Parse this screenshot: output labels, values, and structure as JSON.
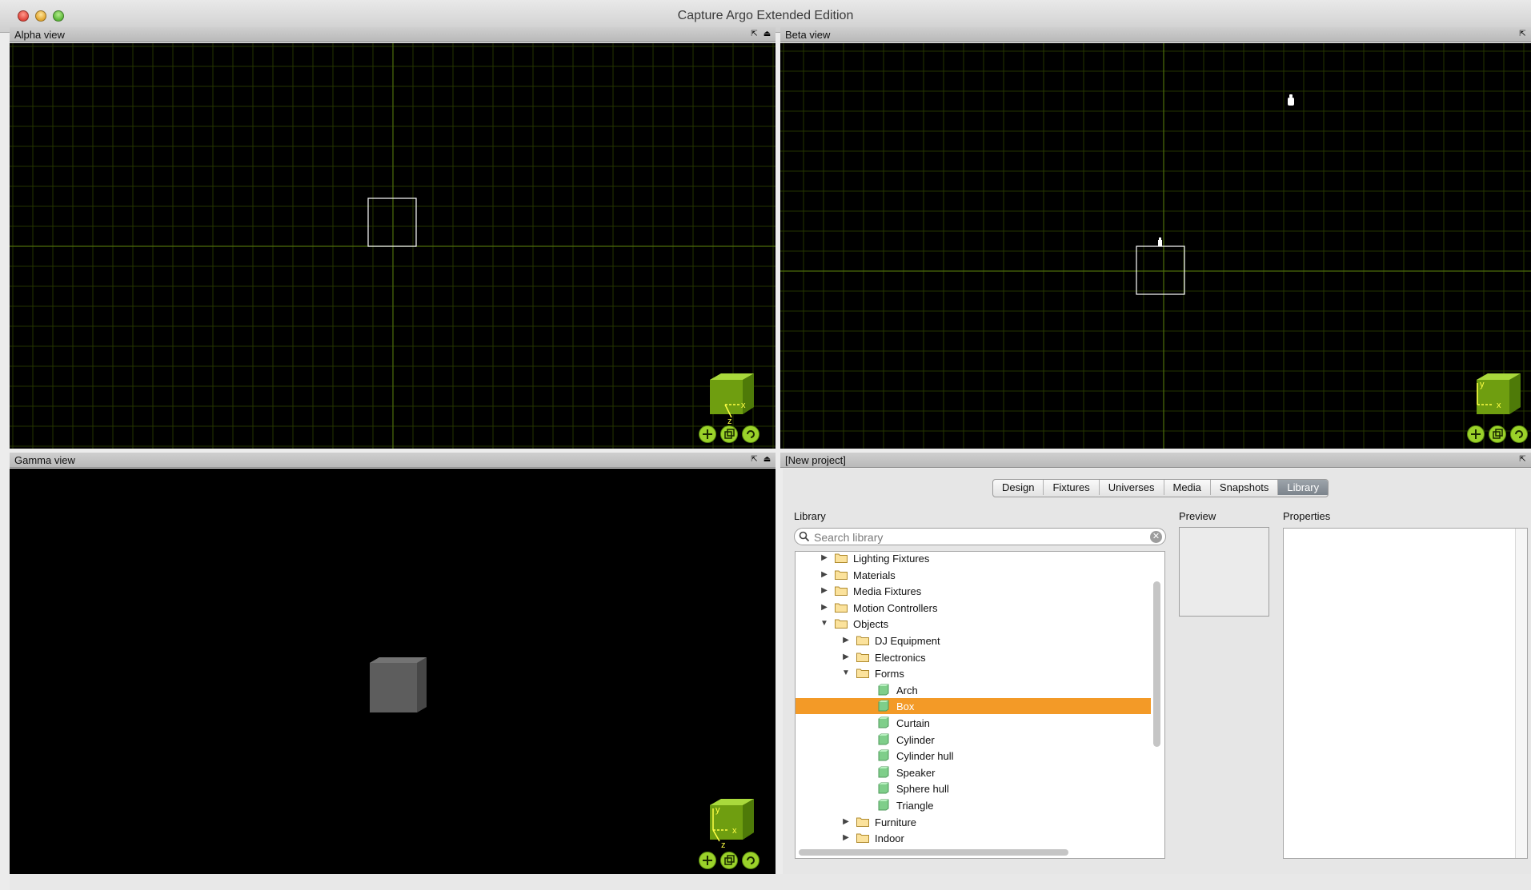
{
  "window": {
    "title": "Capture Argo Extended Edition"
  },
  "views": {
    "alpha": {
      "title": "Alpha view"
    },
    "beta": {
      "title": "Beta view"
    },
    "gamma": {
      "title": "Gamma view"
    }
  },
  "axis_labels": {
    "x": "x",
    "y": "y",
    "z": "z"
  },
  "project_pane": {
    "title": "[New project]"
  },
  "tabs": [
    {
      "label": "Design",
      "active": false
    },
    {
      "label": "Fixtures",
      "active": false
    },
    {
      "label": "Universes",
      "active": false
    },
    {
      "label": "Media",
      "active": false
    },
    {
      "label": "Snapshots",
      "active": false
    },
    {
      "label": "Library",
      "active": true
    }
  ],
  "library": {
    "label": "Library",
    "search_placeholder": "Search library",
    "tree": [
      {
        "label": "Lighting Fixtures",
        "depth": 0,
        "type": "folder",
        "state": "collapsed"
      },
      {
        "label": "Materials",
        "depth": 0,
        "type": "folder",
        "state": "collapsed"
      },
      {
        "label": "Media Fixtures",
        "depth": 0,
        "type": "folder",
        "state": "collapsed"
      },
      {
        "label": "Motion Controllers",
        "depth": 0,
        "type": "folder",
        "state": "collapsed"
      },
      {
        "label": "Objects",
        "depth": 0,
        "type": "folder",
        "state": "expanded"
      },
      {
        "label": "DJ Equipment",
        "depth": 1,
        "type": "folder",
        "state": "collapsed"
      },
      {
        "label": "Electronics",
        "depth": 1,
        "type": "folder",
        "state": "collapsed"
      },
      {
        "label": "Forms",
        "depth": 1,
        "type": "folder",
        "state": "expanded"
      },
      {
        "label": "Arch",
        "depth": 2,
        "type": "item"
      },
      {
        "label": "Box",
        "depth": 2,
        "type": "item",
        "selected": true
      },
      {
        "label": "Curtain",
        "depth": 2,
        "type": "item"
      },
      {
        "label": "Cylinder",
        "depth": 2,
        "type": "item"
      },
      {
        "label": "Cylinder hull",
        "depth": 2,
        "type": "item"
      },
      {
        "label": "Speaker",
        "depth": 2,
        "type": "item"
      },
      {
        "label": "Sphere hull",
        "depth": 2,
        "type": "item"
      },
      {
        "label": "Triangle",
        "depth": 2,
        "type": "item"
      },
      {
        "label": "Furniture",
        "depth": 1,
        "type": "folder",
        "state": "collapsed"
      },
      {
        "label": "Indoor",
        "depth": 1,
        "type": "folder",
        "state": "collapsed"
      }
    ]
  },
  "preview": {
    "label": "Preview"
  },
  "properties": {
    "label": "Properties"
  },
  "colors": {
    "grid": "#243500",
    "grid_axis": "#4c6e0a",
    "selection": "#f39a27",
    "nav_green": "#9bd22a"
  },
  "icons": {
    "pane_pin": "pin-icon",
    "pane_eject": "eject-icon",
    "nav": [
      "move-icon",
      "zoom-icon",
      "rotate-icon"
    ]
  }
}
